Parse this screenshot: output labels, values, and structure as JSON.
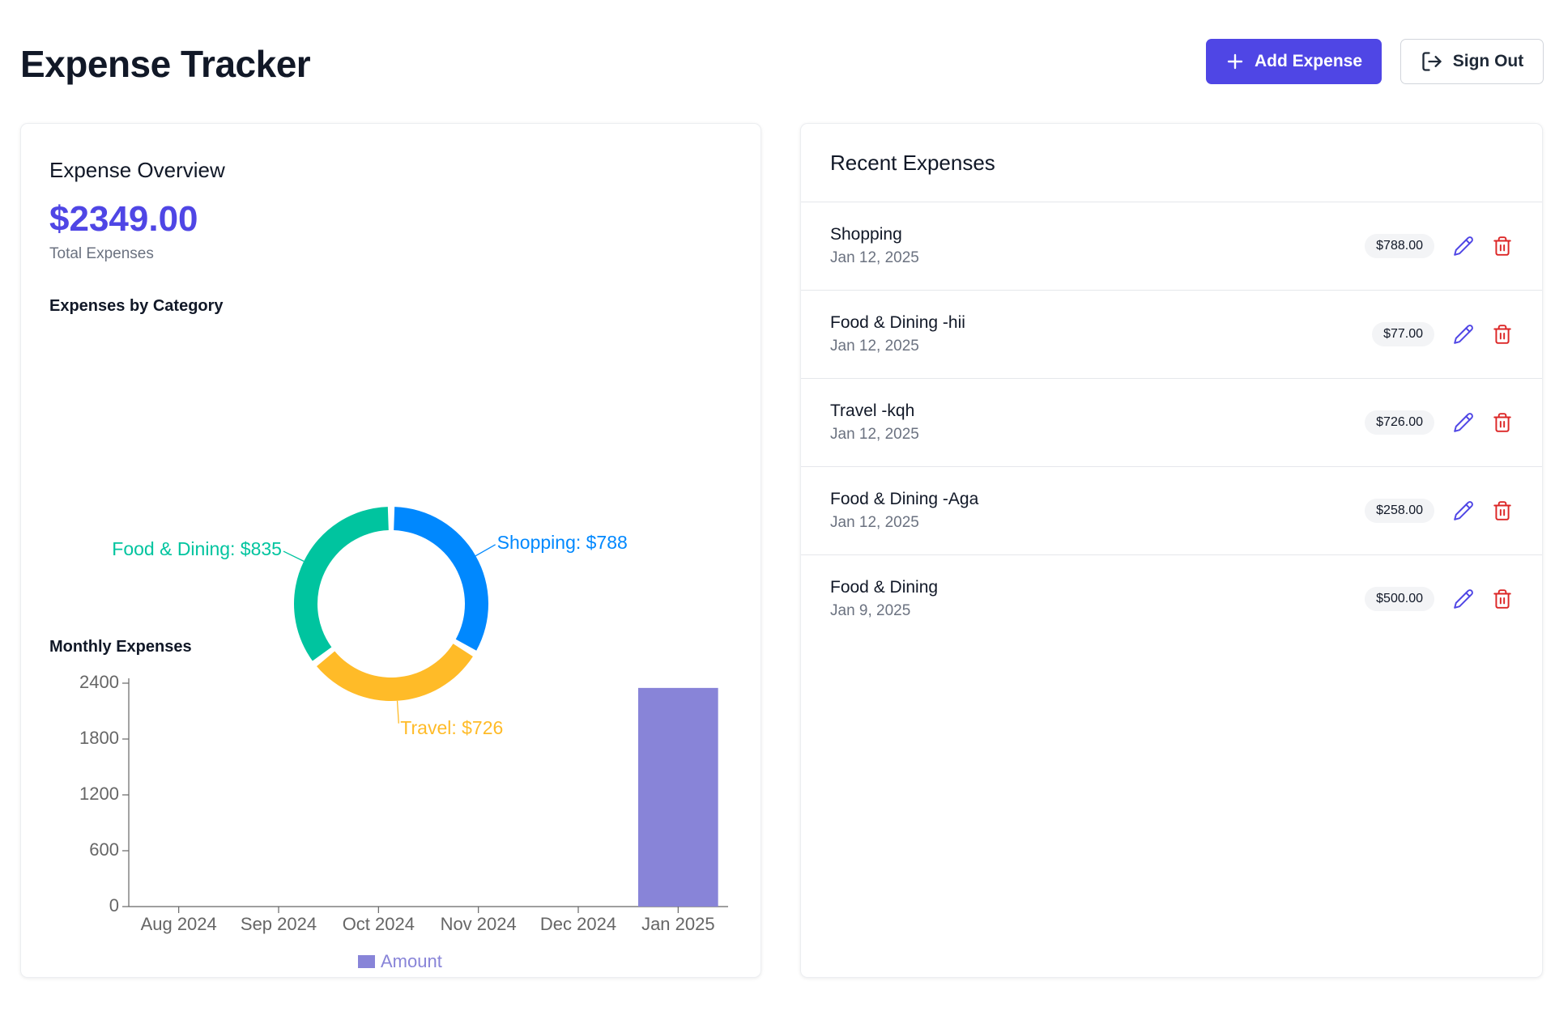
{
  "header": {
    "title": "Expense Tracker",
    "add_expense_label": "Add Expense",
    "sign_out_label": "Sign Out",
    "add_icon": "plus-icon",
    "sign_out_icon": "log-out-icon"
  },
  "overview": {
    "title": "Expense Overview",
    "total_amount": "$2349.00",
    "total_label": "Total Expenses",
    "category_title": "Expenses by Category",
    "monthly_title": "Monthly Expenses"
  },
  "recent": {
    "title": "Recent Expenses",
    "items": [
      {
        "name": "Shopping",
        "date": "Jan 12, 2025",
        "amount": "$788.00"
      },
      {
        "name": "Food & Dining -hii",
        "date": "Jan 12, 2025",
        "amount": "$77.00"
      },
      {
        "name": "Travel -kqh",
        "date": "Jan 12, 2025",
        "amount": "$726.00"
      },
      {
        "name": "Food & Dining -Aga",
        "date": "Jan 12, 2025",
        "amount": "$258.00"
      },
      {
        "name": "Food & Dining",
        "date": "Jan 9, 2025",
        "amount": "$500.00"
      }
    ]
  },
  "colors": {
    "accent": "#4f46e5",
    "edit_icon": "#4f46e5",
    "delete_icon": "#dc2626",
    "shopping": "#0088fe",
    "food": "#00c49f",
    "travel": "#ffbb28",
    "bar": "#8884d8"
  },
  "chart_data": [
    {
      "type": "pie",
      "title": "Expenses by Category",
      "slices": [
        {
          "label": "Shopping",
          "value": 788,
          "display": "Shopping: $788",
          "color": "#0088fe"
        },
        {
          "label": "Travel",
          "value": 726,
          "display": "Travel: $726",
          "color": "#ffbb28"
        },
        {
          "label": "Food & Dining",
          "value": 835,
          "display": "Food & Dining: $835",
          "color": "#00c49f"
        }
      ],
      "donut": true
    },
    {
      "type": "bar",
      "title": "Monthly Expenses",
      "categories": [
        "Aug 2024",
        "Sep 2024",
        "Oct 2024",
        "Nov 2024",
        "Dec 2024",
        "Jan 2025"
      ],
      "series": [
        {
          "name": "Amount",
          "values": [
            0,
            0,
            0,
            0,
            0,
            2349
          ],
          "color": "#8884d8"
        }
      ],
      "yticks": [
        0,
        600,
        1200,
        1800,
        2400
      ],
      "ylim": [
        0,
        2400
      ],
      "legend": "bottom"
    }
  ]
}
